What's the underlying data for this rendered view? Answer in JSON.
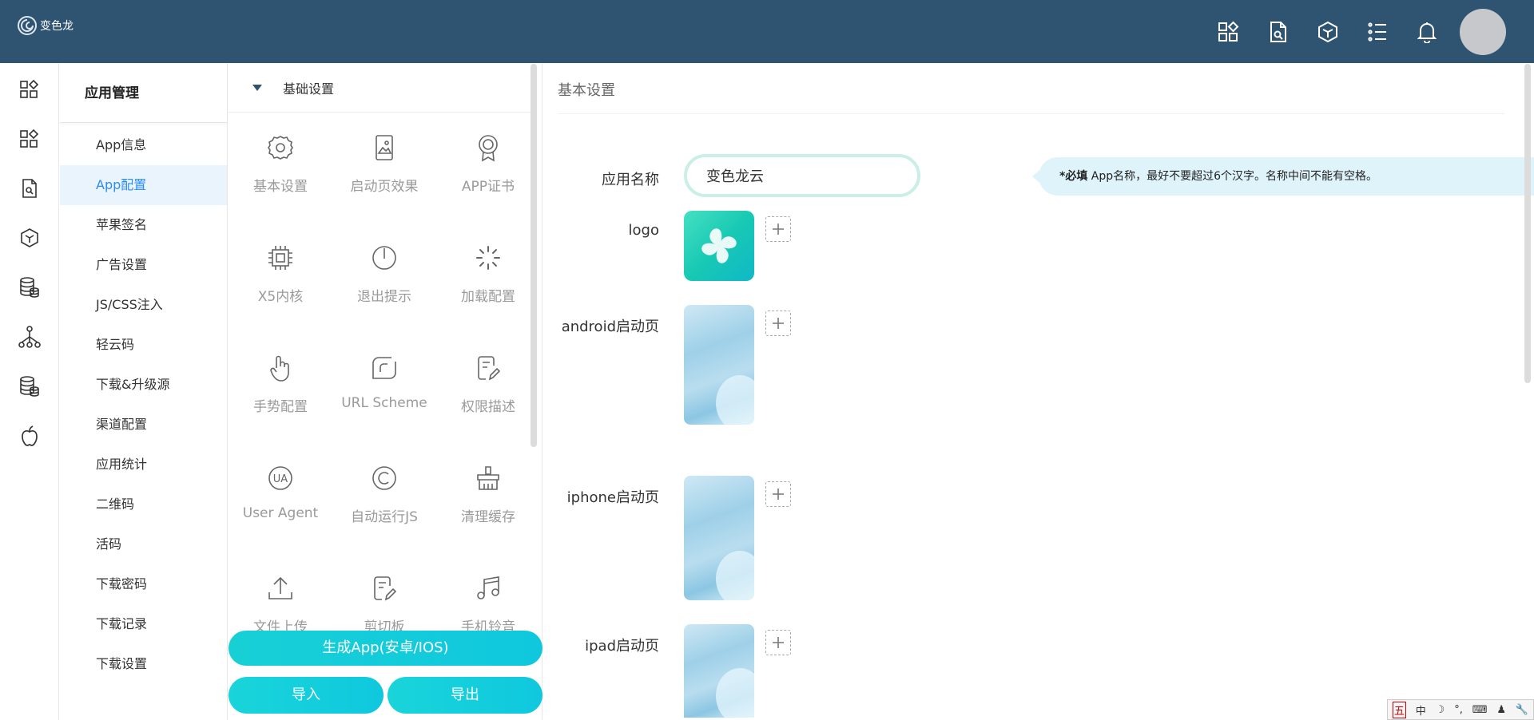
{
  "app": {
    "logo_text": "变色龙"
  },
  "header": {
    "icons": [
      "apps-icon",
      "document-icon",
      "box-icon",
      "list-icon",
      "bell-icon"
    ]
  },
  "icon_rail": [
    "apps-icon",
    "apps-icon",
    "document-icon",
    "box-icon",
    "database-icon",
    "sitemap-icon",
    "database-icon",
    "apple-icon"
  ],
  "menu": {
    "title": "应用管理",
    "items": [
      "App信息",
      "App配置",
      "苹果签名",
      "广告设置",
      "JS/CSS注入",
      "轻云码",
      "下载&升级源",
      "渠道配置",
      "应用统计",
      "二维码",
      "活码",
      "下载密码",
      "下载记录",
      "下载设置"
    ],
    "active_index": 1
  },
  "features": {
    "section": "基础设置",
    "items": [
      {
        "label": "基本设置",
        "icon": "gear-icon"
      },
      {
        "label": "启动页效果",
        "icon": "phone-image-icon"
      },
      {
        "label": "APP证书",
        "icon": "certificate-icon"
      },
      {
        "label": "X5内核",
        "icon": "chip-icon"
      },
      {
        "label": "退出提示",
        "icon": "power-icon"
      },
      {
        "label": "加载配置",
        "icon": "loading-icon"
      },
      {
        "label": "手势配置",
        "icon": "hand-icon"
      },
      {
        "label": "URL Scheme",
        "icon": "scheme-icon"
      },
      {
        "label": "权限描述",
        "icon": "edit-doc-icon"
      },
      {
        "label": "User Agent",
        "icon": "ua-icon"
      },
      {
        "label": "自动运行JS",
        "icon": "copyright-icon"
      },
      {
        "label": "清理缓存",
        "icon": "broom-icon"
      },
      {
        "label": "文件上传",
        "icon": "upload-icon"
      },
      {
        "label": "剪切板",
        "icon": "clipboard-icon"
      },
      {
        "label": "手机铃音",
        "icon": "music-icon"
      }
    ]
  },
  "actions": {
    "generate": "生成App(安卓/IOS)",
    "import": "导入",
    "export": "导出"
  },
  "content": {
    "section_title": "基本设置",
    "app_name_label": "应用名称",
    "app_name_value": "变色龙云",
    "tip_required": "*必填",
    "tip_text": " App名称，最好不要超过6个汉字。名称中间不能有空格。",
    "logo_label": "logo",
    "android_label": "android启动页",
    "iphone_label": "iphone启动页",
    "ipad_label": "ipad启动页"
  },
  "ime": [
    "五",
    "中",
    "☽",
    "°,",
    "⌨",
    "♟",
    "🔧"
  ]
}
